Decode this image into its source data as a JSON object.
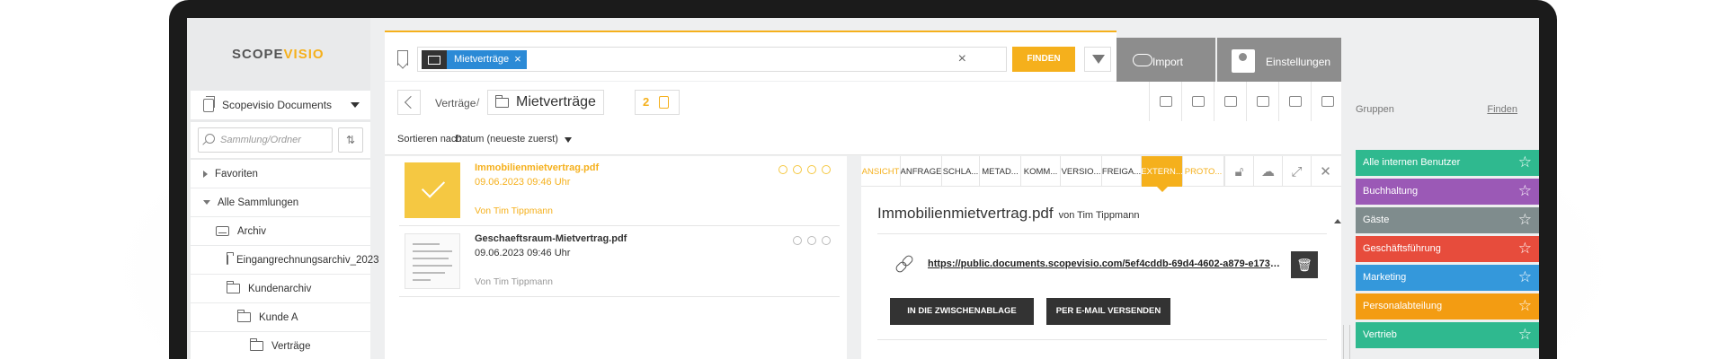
{
  "brand": {
    "logo_main": "SCOPE",
    "logo_accent": "VISIO"
  },
  "sidebar": {
    "collection_select": "Scopevisio Documents",
    "search_placeholder": "Sammlung/Ordner",
    "sort_icon": "sort-icon",
    "tree": [
      {
        "label": "Favoriten",
        "level": 0,
        "icon": "triangle-right"
      },
      {
        "label": "Alle Sammlungen",
        "level": 0,
        "icon": "triangle-down"
      },
      {
        "label": "Archiv",
        "level": 1,
        "icon": "inbox"
      },
      {
        "label": "Eingangrechnungsarchiv_2023",
        "level": 2,
        "icon": "folder"
      },
      {
        "label": "Kundenarchiv",
        "level": 2,
        "icon": "folder"
      },
      {
        "label": "Kunde A",
        "level": 3,
        "icon": "folder"
      },
      {
        "label": "Verträge",
        "level": 4,
        "icon": "folder"
      }
    ]
  },
  "search": {
    "chip_label": "Mietverträge",
    "find_label": "FINDEN"
  },
  "toolbar": {
    "import_label": "Import",
    "settings_label": "Einstellungen"
  },
  "breadcrumb": {
    "parent": "Verträge",
    "separator": "/",
    "current": "Mietverträge",
    "count": "2"
  },
  "sort": {
    "label": "Sortieren nach:",
    "value": "Datum (neueste zuerst)"
  },
  "files": [
    {
      "name": "Immobilienmietvertrag.pdf",
      "date": "09.06.2023 09:46 Uhr",
      "author": "Von Tim Tippmann",
      "active": true
    },
    {
      "name": "Geschaeftsraum-Mietvertrag.pdf",
      "date": "09.06.2023 09:46 Uhr",
      "author": "Von Tim Tippmann",
      "active": false
    }
  ],
  "detail": {
    "tabs": [
      "ANSICHT",
      "ANFRAGE",
      "SCHLA...",
      "METAD...",
      "KOMM...",
      "VERSIO...",
      "FREIGA...",
      "EXTERN...",
      "PROTO..."
    ],
    "title": "Immobilienmietvertrag.pdf",
    "author": "von Tim Tippmann",
    "url": "https://public.documents.scopevisio.com/5ef4cddb-69d4-4602-a879-e17303f...",
    "copy_label": "IN DIE ZWISCHENABLAGE KOPIEREN",
    "mail_label": "PER E-MAIL VERSENDEN"
  },
  "groups": {
    "title": "Gruppen",
    "find_label": "Finden",
    "items": [
      {
        "label": "Alle internen Benutzer",
        "color": "#2fb98f"
      },
      {
        "label": "Buchhaltung",
        "color": "#9b59b6"
      },
      {
        "label": "Gäste",
        "color": "#7f8c8d"
      },
      {
        "label": "Geschäftsführung",
        "color": "#e74c3c"
      },
      {
        "label": "Marketing",
        "color": "#3498db"
      },
      {
        "label": "Personalabteilung",
        "color": "#f39c12"
      },
      {
        "label": "Vertrieb",
        "color": "#2fb98f"
      }
    ]
  }
}
